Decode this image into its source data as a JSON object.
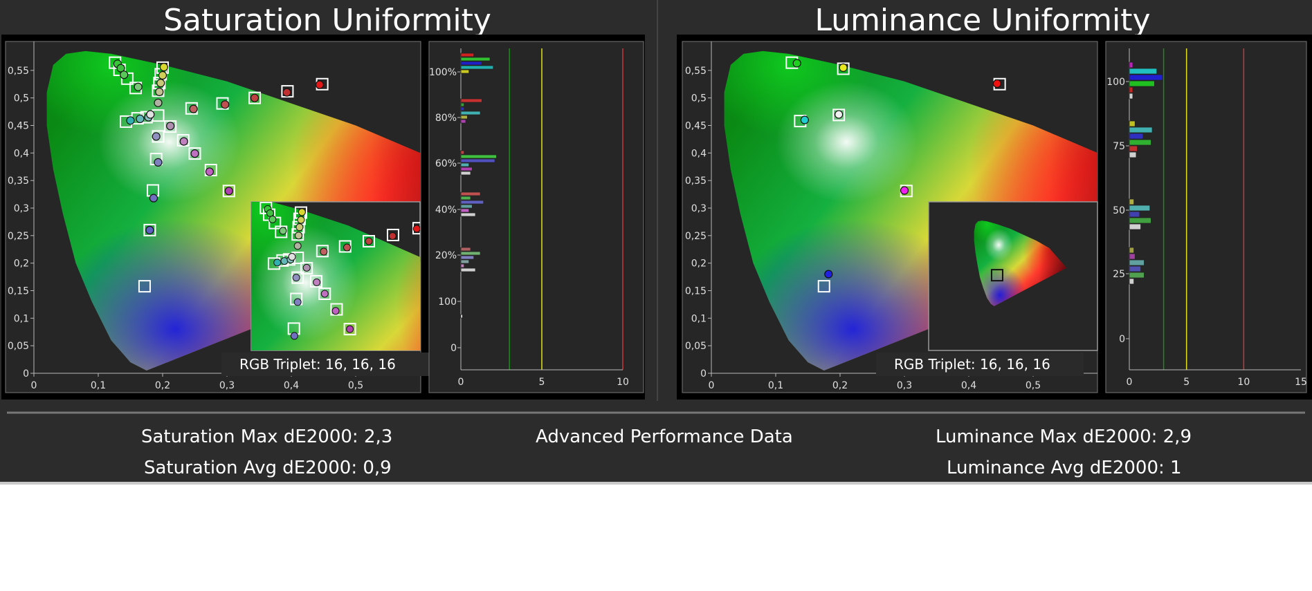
{
  "panels": {
    "left_title": "Saturation Uniformity",
    "right_title": "Luminance Uniformity"
  },
  "footer": {
    "sat_max": "Saturation Max dE2000: 2,3",
    "sat_avg": "Saturation Avg dE2000: 0,9",
    "center": "Advanced Performance Data",
    "lum_max": "Luminance Max dE2000: 2,9",
    "lum_avg": "Luminance Avg dE2000: 1"
  },
  "colors": {
    "background": "#2c2c2c",
    "plot_bg": "#262626",
    "green_line": "#1c8c1c",
    "yellow_line": "#e4e41c",
    "red_line": "#c83838"
  },
  "chart_data": [
    {
      "type": "scatter",
      "name": "saturation_cie",
      "title": "Saturation Uniformity",
      "xlim": [
        0,
        0.6
      ],
      "ylim": [
        0,
        0.6
      ],
      "x_ticks": [
        "0",
        "0,1",
        "0,2",
        "0,3",
        "0,4",
        "0,5"
      ],
      "y_ticks": [
        "0",
        "0,05",
        "0,1",
        "0,15",
        "0,2",
        "0,25",
        "0,3",
        "0,35",
        "0,4",
        "0,45",
        "0,5",
        "0,55"
      ],
      "rgb_triplet": "RGB Triplet: 16, 16, 16",
      "targets": [
        {
          "x": 0.126,
          "y": 0.564
        },
        {
          "x": 0.133,
          "y": 0.551
        },
        {
          "x": 0.145,
          "y": 0.535
        },
        {
          "x": 0.158,
          "y": 0.518
        },
        {
          "x": 0.2,
          "y": 0.555
        },
        {
          "x": 0.197,
          "y": 0.543
        },
        {
          "x": 0.195,
          "y": 0.527
        },
        {
          "x": 0.193,
          "y": 0.513
        },
        {
          "x": 0.143,
          "y": 0.457
        },
        {
          "x": 0.161,
          "y": 0.463
        },
        {
          "x": 0.175,
          "y": 0.465
        },
        {
          "x": 0.193,
          "y": 0.468
        },
        {
          "x": 0.245,
          "y": 0.481
        },
        {
          "x": 0.293,
          "y": 0.49
        },
        {
          "x": 0.343,
          "y": 0.5
        },
        {
          "x": 0.394,
          "y": 0.512
        },
        {
          "x": 0.448,
          "y": 0.525
        },
        {
          "x": 0.212,
          "y": 0.448
        },
        {
          "x": 0.232,
          "y": 0.423
        },
        {
          "x": 0.25,
          "y": 0.399
        },
        {
          "x": 0.275,
          "y": 0.369
        },
        {
          "x": 0.303,
          "y": 0.331
        },
        {
          "x": 0.193,
          "y": 0.43
        },
        {
          "x": 0.19,
          "y": 0.389
        },
        {
          "x": 0.185,
          "y": 0.332
        },
        {
          "x": 0.18,
          "y": 0.26
        },
        {
          "x": 0.172,
          "y": 0.158
        }
      ],
      "measured": [
        {
          "x": 0.13,
          "y": 0.562,
          "c": "#38c838"
        },
        {
          "x": 0.135,
          "y": 0.554,
          "c": "#40c040"
        },
        {
          "x": 0.14,
          "y": 0.542,
          "c": "#58c858"
        },
        {
          "x": 0.162,
          "y": 0.52,
          "c": "#78c878"
        },
        {
          "x": 0.202,
          "y": 0.556,
          "c": "#d8d830"
        },
        {
          "x": 0.2,
          "y": 0.541,
          "c": "#d0d058"
        },
        {
          "x": 0.197,
          "y": 0.527,
          "c": "#c8c878"
        },
        {
          "x": 0.195,
          "y": 0.511,
          "c": "#c0c090"
        },
        {
          "x": 0.15,
          "y": 0.459,
          "c": "#30b0b0"
        },
        {
          "x": 0.165,
          "y": 0.462,
          "c": "#60b8b8"
        },
        {
          "x": 0.178,
          "y": 0.465,
          "c": "#88c0c0"
        },
        {
          "x": 0.193,
          "y": 0.491,
          "c": "#b0b0a0"
        },
        {
          "x": 0.248,
          "y": 0.48,
          "c": "#c06060"
        },
        {
          "x": 0.297,
          "y": 0.488,
          "c": "#c05050"
        },
        {
          "x": 0.343,
          "y": 0.5,
          "c": "#c04040"
        },
        {
          "x": 0.393,
          "y": 0.51,
          "c": "#c03030"
        },
        {
          "x": 0.444,
          "y": 0.524,
          "c": "#e01818"
        },
        {
          "x": 0.212,
          "y": 0.449,
          "c": "#b090b0"
        },
        {
          "x": 0.233,
          "y": 0.421,
          "c": "#c080c0"
        },
        {
          "x": 0.25,
          "y": 0.399,
          "c": "#c070c0"
        },
        {
          "x": 0.273,
          "y": 0.366,
          "c": "#c060c0"
        },
        {
          "x": 0.303,
          "y": 0.331,
          "c": "#b040b0"
        },
        {
          "x": 0.19,
          "y": 0.43,
          "c": "#9090c0"
        },
        {
          "x": 0.193,
          "y": 0.383,
          "c": "#8080c0"
        },
        {
          "x": 0.186,
          "y": 0.318,
          "c": "#7070c0"
        },
        {
          "x": 0.18,
          "y": 0.26,
          "c": "#6060c0"
        },
        {
          "x": 0.181,
          "y": 0.47,
          "c": "#e0e0e0"
        }
      ]
    },
    {
      "type": "bar",
      "name": "saturation_de",
      "orientation": "horizontal",
      "y_ticks": [
        "100%",
        "80%",
        "60%",
        "40%",
        "20%",
        "100",
        "0"
      ],
      "x_ticks": [
        "0",
        "5",
        "10"
      ],
      "xlim": [
        0,
        10
      ],
      "thresholds": [
        3,
        5,
        10
      ],
      "groups": [
        {
          "level": "100%",
          "values": [
            0.8,
            1.8,
            1.3,
            2.0,
            0.5
          ],
          "colors": [
            "#d02020",
            "#30c030",
            "#2020c8",
            "#20b0b0",
            "#c8c820"
          ]
        },
        {
          "level": "80%",
          "values": [
            1.3,
            0.2,
            0.2,
            1.2,
            0.4,
            0.3
          ],
          "colors": [
            "#c83030",
            "#30a030",
            "#3030c0",
            "#40b0b0",
            "#b0b040",
            "#b040b0"
          ]
        },
        {
          "level": "60%",
          "values": [
            0.2,
            2.2,
            2.1,
            0.5,
            0.7,
            0.6
          ],
          "colors": [
            "#c84040",
            "#40c040",
            "#5050c0",
            "#50b0b0",
            "#b040b0",
            "#d0d0d0"
          ]
        },
        {
          "level": "40%",
          "values": [
            1.2,
            0.6,
            1.4,
            0.7,
            0.5,
            0.9
          ],
          "colors": [
            "#c05050",
            "#50b050",
            "#6060c0",
            "#60a0a0",
            "#c060c0",
            "#d0d0d0"
          ]
        },
        {
          "level": "20%",
          "values": [
            0.6,
            1.2,
            0.8,
            0.5,
            0.2,
            0.9
          ],
          "colors": [
            "#b06060",
            "#70b070",
            "#8080c0",
            "#80a0a0",
            "#c080c0",
            "#d0d0d0"
          ]
        },
        {
          "level": "100",
          "values": [
            0.1
          ],
          "colors": [
            "#ffffff"
          ]
        }
      ]
    },
    {
      "type": "scatter",
      "name": "luminance_cie",
      "title": "Luminance Uniformity",
      "xlim": [
        0,
        0.6
      ],
      "ylim": [
        0,
        0.6
      ],
      "x_ticks": [
        "0",
        "0,1",
        "0,2",
        "0,3",
        "0,4",
        "0,5"
      ],
      "y_ticks": [
        "0",
        "0,05",
        "0,1",
        "0,15",
        "0,2",
        "0,25",
        "0,3",
        "0,35",
        "0,4",
        "0,45",
        "0,5",
        "0,55"
      ],
      "rgb_triplet": "RGB Triplet: 16, 16, 16",
      "targets": [
        {
          "x": 0.125,
          "y": 0.564
        },
        {
          "x": 0.205,
          "y": 0.553
        },
        {
          "x": 0.448,
          "y": 0.525
        },
        {
          "x": 0.198,
          "y": 0.469
        },
        {
          "x": 0.138,
          "y": 0.458
        },
        {
          "x": 0.303,
          "y": 0.331
        },
        {
          "x": 0.175,
          "y": 0.158
        }
      ],
      "measured": [
        {
          "x": 0.133,
          "y": 0.563,
          "c": "#20d020"
        },
        {
          "x": 0.205,
          "y": 0.555,
          "c": "#e8e820"
        },
        {
          "x": 0.444,
          "y": 0.526,
          "c": "#f01010"
        },
        {
          "x": 0.198,
          "y": 0.47,
          "c": "#f0f0f0"
        },
        {
          "x": 0.145,
          "y": 0.46,
          "c": "#20d0d0"
        },
        {
          "x": 0.3,
          "y": 0.332,
          "c": "#f020f0"
        },
        {
          "x": 0.182,
          "y": 0.18,
          "c": "#2020e0"
        }
      ]
    },
    {
      "type": "bar",
      "name": "luminance_de",
      "orientation": "horizontal",
      "y_ticks": [
        "100",
        "75",
        "50",
        "25",
        "0"
      ],
      "x_ticks": [
        "0",
        "5",
        "10",
        "15"
      ],
      "xlim": [
        0,
        15
      ],
      "thresholds": [
        3,
        5,
        10
      ],
      "groups": [
        {
          "level": "100",
          "values": [
            0.3,
            2.4,
            2.9,
            2.2,
            0.3,
            0.3
          ],
          "colors": [
            "#c020c0",
            "#20c0c0",
            "#2020d0",
            "#20c020",
            "#d02020",
            "#d0d0d0"
          ]
        },
        {
          "level": "75",
          "values": [
            0.5,
            2.0,
            1.2,
            1.9,
            0.7,
            0.6
          ],
          "colors": [
            "#c0c020",
            "#40b0b0",
            "#3030c0",
            "#30b030",
            "#c03030",
            "#d0d0d0"
          ]
        },
        {
          "level": "50",
          "values": [
            0.4,
            1.8,
            0.9,
            1.9,
            1.0
          ],
          "colors": [
            "#b0b040",
            "#50b0b0",
            "#4040b0",
            "#40a040",
            "#d0d0d0"
          ]
        },
        {
          "level": "25",
          "values": [
            0.4,
            0.5,
            1.3,
            1.0,
            1.3,
            0.4
          ],
          "colors": [
            "#a0a040",
            "#a040a0",
            "#60a0a0",
            "#5050b0",
            "#50a050",
            "#d0d0d0"
          ]
        }
      ]
    }
  ]
}
